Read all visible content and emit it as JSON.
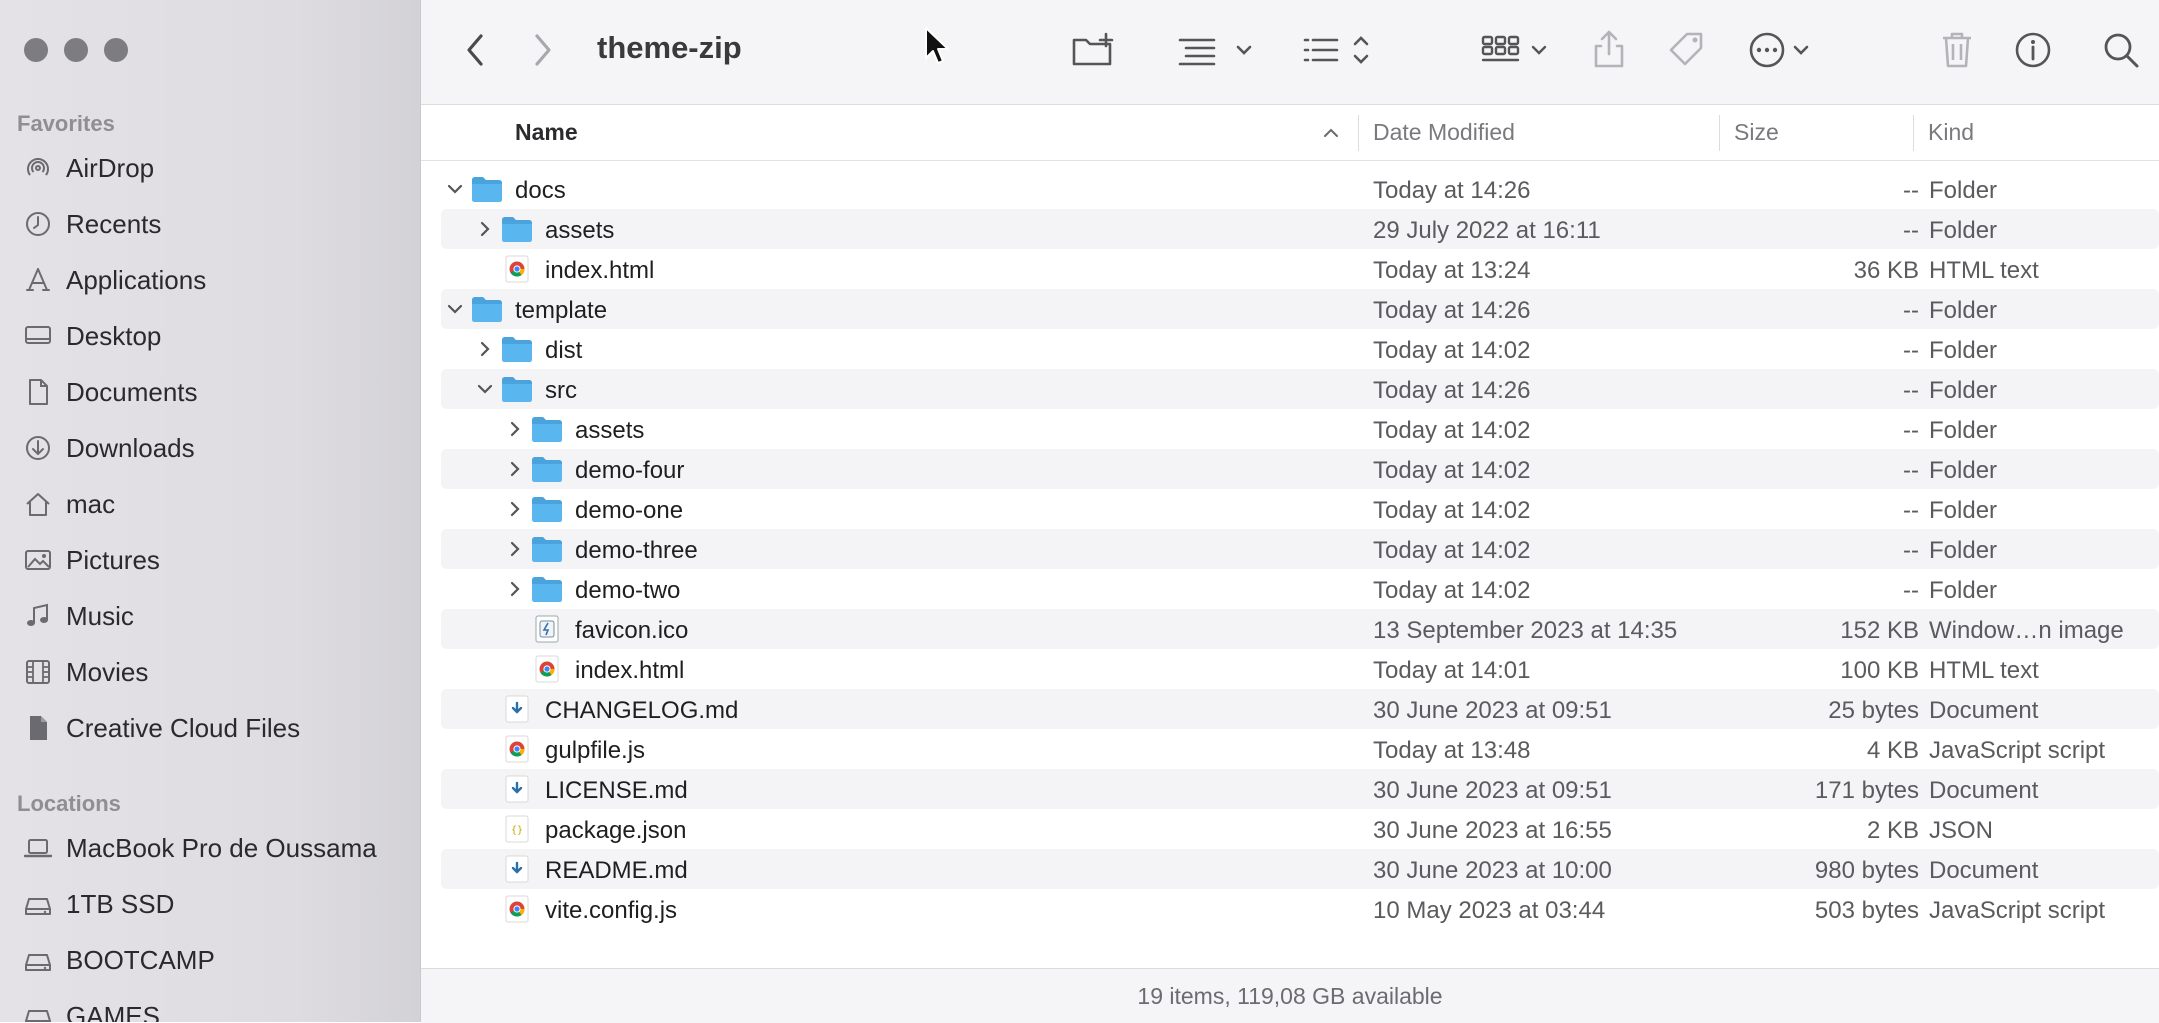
{
  "window": {
    "title": "theme-zip"
  },
  "sidebar": {
    "favorites_label": "Favorites",
    "favorites": [
      {
        "label": "AirDrop",
        "icon": "airdrop-icon"
      },
      {
        "label": "Recents",
        "icon": "clock-icon"
      },
      {
        "label": "Applications",
        "icon": "applications-icon"
      },
      {
        "label": "Desktop",
        "icon": "desktop-icon"
      },
      {
        "label": "Documents",
        "icon": "document-icon"
      },
      {
        "label": "Downloads",
        "icon": "download-icon"
      },
      {
        "label": "mac",
        "icon": "home-icon"
      },
      {
        "label": "Pictures",
        "icon": "photo-icon"
      },
      {
        "label": "Music",
        "icon": "music-note-icon"
      },
      {
        "label": "Movies",
        "icon": "film-icon"
      },
      {
        "label": "Creative Cloud Files",
        "icon": "file-icon"
      }
    ],
    "locations_label": "Locations",
    "locations": [
      {
        "label": "MacBook Pro de Oussama",
        "icon": "laptop-icon"
      },
      {
        "label": "1TB SSD",
        "icon": "drive-icon"
      },
      {
        "label": "BOOTCAMP",
        "icon": "drive-icon"
      },
      {
        "label": "GAMES",
        "icon": "drive-icon"
      }
    ]
  },
  "columns": {
    "name": "Name",
    "date": "Date Modified",
    "size": "Size",
    "kind": "Kind"
  },
  "files": [
    {
      "depth": 0,
      "disclosure": "open",
      "type": "folder",
      "name": "docs",
      "date": "Today at 14:26",
      "size": "--",
      "kind": "Folder"
    },
    {
      "depth": 1,
      "disclosure": "closed",
      "type": "folder",
      "name": "assets",
      "date": "29 July 2022 at 16:11",
      "size": "--",
      "kind": "Folder"
    },
    {
      "depth": 1,
      "disclosure": "none",
      "type": "chrome",
      "name": "index.html",
      "date": "Today at 13:24",
      "size": "36 KB",
      "kind": "HTML text"
    },
    {
      "depth": 0,
      "disclosure": "open",
      "type": "folder",
      "name": "template",
      "date": "Today at 14:26",
      "size": "--",
      "kind": "Folder"
    },
    {
      "depth": 1,
      "disclosure": "closed",
      "type": "folder",
      "name": "dist",
      "date": "Today at 14:02",
      "size": "--",
      "kind": "Folder"
    },
    {
      "depth": 1,
      "disclosure": "open",
      "type": "folder",
      "name": "src",
      "date": "Today at 14:26",
      "size": "--",
      "kind": "Folder"
    },
    {
      "depth": 2,
      "disclosure": "closed",
      "type": "folder",
      "name": "assets",
      "date": "Today at 14:02",
      "size": "--",
      "kind": "Folder"
    },
    {
      "depth": 2,
      "disclosure": "closed",
      "type": "folder",
      "name": "demo-four",
      "date": "Today at 14:02",
      "size": "--",
      "kind": "Folder"
    },
    {
      "depth": 2,
      "disclosure": "closed",
      "type": "folder",
      "name": "demo-one",
      "date": "Today at 14:02",
      "size": "--",
      "kind": "Folder"
    },
    {
      "depth": 2,
      "disclosure": "closed",
      "type": "folder",
      "name": "demo-three",
      "date": "Today at 14:02",
      "size": "--",
      "kind": "Folder"
    },
    {
      "depth": 2,
      "disclosure": "closed",
      "type": "folder",
      "name": "demo-two",
      "date": "Today at 14:02",
      "size": "--",
      "kind": "Folder"
    },
    {
      "depth": 2,
      "disclosure": "none",
      "type": "ico",
      "name": "favicon.ico",
      "date": "13 September 2023 at 14:35",
      "size": "152 KB",
      "kind": "Window…n image"
    },
    {
      "depth": 2,
      "disclosure": "none",
      "type": "chrome",
      "name": "index.html",
      "date": "Today at 14:01",
      "size": "100 KB",
      "kind": "HTML text"
    },
    {
      "depth": 1,
      "disclosure": "none",
      "type": "md",
      "name": "CHANGELOG.md",
      "date": "30 June 2023 at 09:51",
      "size": "25 bytes",
      "kind": "Document"
    },
    {
      "depth": 1,
      "disclosure": "none",
      "type": "chrome",
      "name": "gulpfile.js",
      "date": "Today at 13:48",
      "size": "4 KB",
      "kind": "JavaScript script"
    },
    {
      "depth": 1,
      "disclosure": "none",
      "type": "md",
      "name": "LICENSE.md",
      "date": "30 June 2023 at 09:51",
      "size": "171 bytes",
      "kind": "Document"
    },
    {
      "depth": 1,
      "disclosure": "none",
      "type": "json",
      "name": "package.json",
      "date": "30 June 2023 at 16:55",
      "size": "2 KB",
      "kind": "JSON"
    },
    {
      "depth": 1,
      "disclosure": "none",
      "type": "md",
      "name": "README.md",
      "date": "30 June 2023 at 10:00",
      "size": "980 bytes",
      "kind": "Document"
    },
    {
      "depth": 1,
      "disclosure": "none",
      "type": "chrome",
      "name": "vite.config.js",
      "date": "10 May 2023 at 03:44",
      "size": "503 bytes",
      "kind": "JavaScript script"
    }
  ],
  "status": "19 items, 119,08 GB available",
  "colors": {
    "folder": "#5ab6ee",
    "folder_tab": "#4aa3dc",
    "accent": "#0a84ff"
  }
}
